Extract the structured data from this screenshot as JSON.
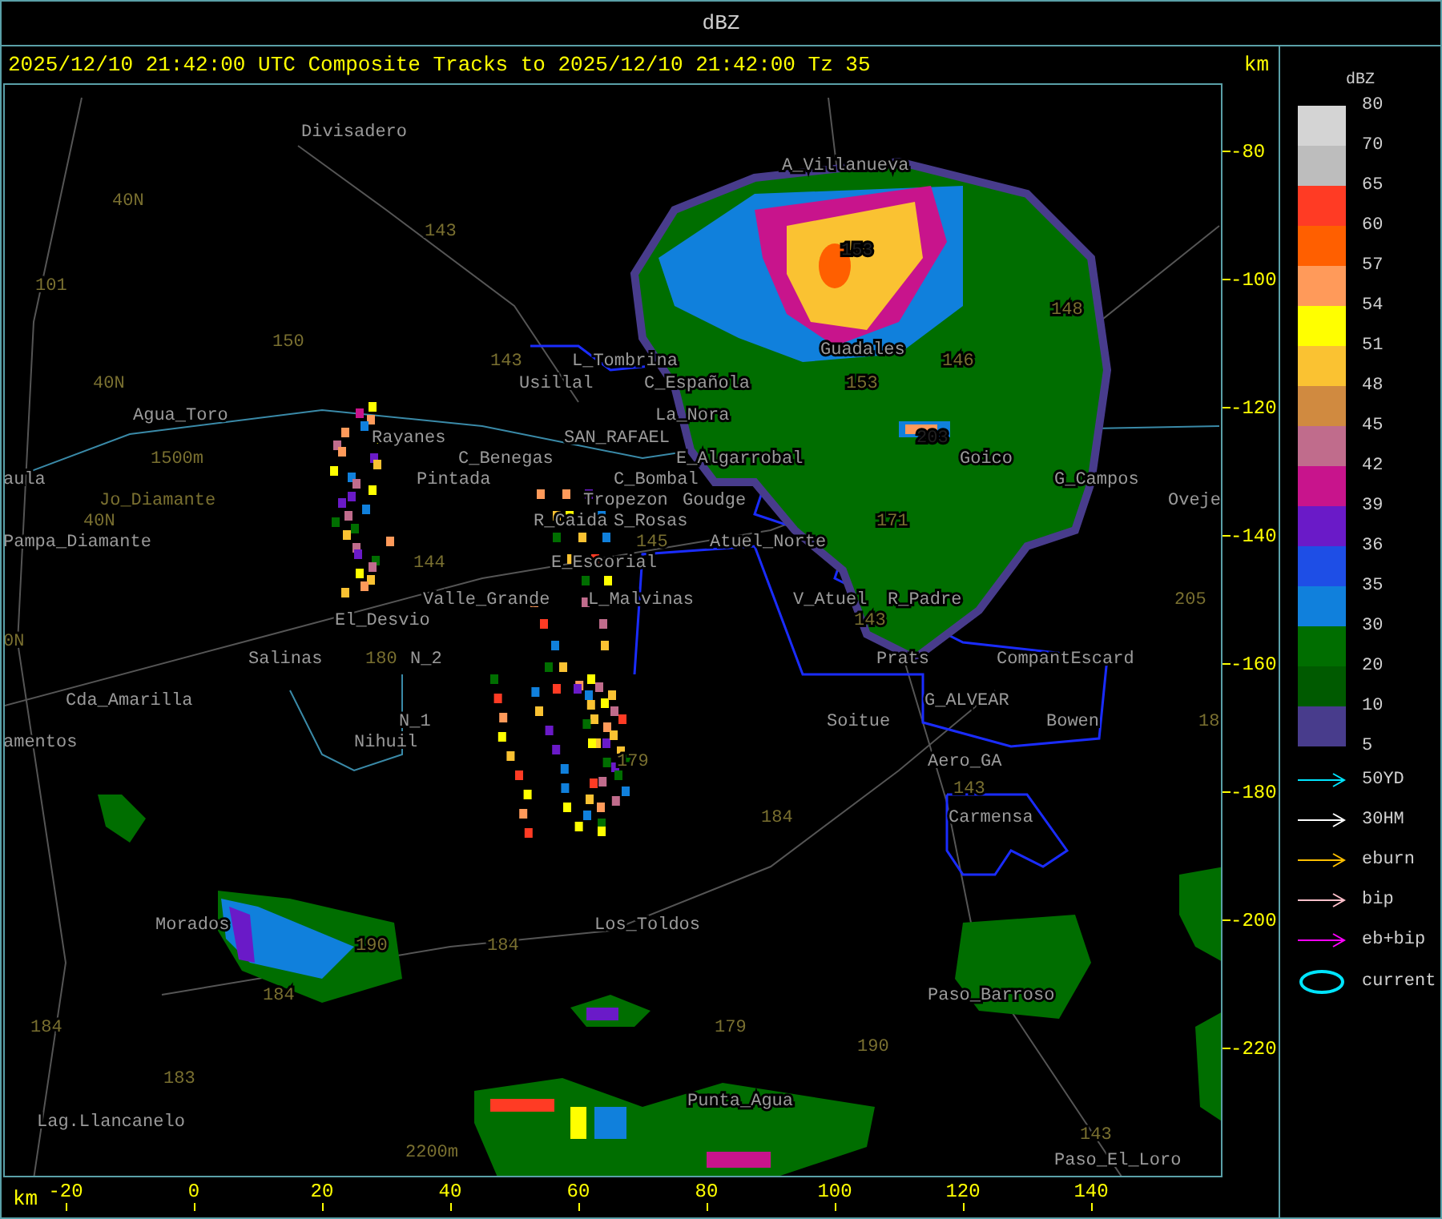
{
  "window": {
    "title": "dBZ"
  },
  "header": {
    "caption": "2025/12/10 21:42:00 UTC Composite Tracks to 2025/12/10 21:42:00 Tz 35",
    "unit": "km"
  },
  "map": {
    "labels": [
      {
        "text": "Divisadero",
        "kind": "place"
      },
      {
        "text": "A_Villanueva",
        "kind": "place"
      },
      {
        "text": "40N",
        "kind": "route"
      },
      {
        "text": "143",
        "kind": "route"
      },
      {
        "text": "153",
        "kind": "route_dark"
      },
      {
        "text": "101",
        "kind": "route"
      },
      {
        "text": "148",
        "kind": "route"
      },
      {
        "text": "150",
        "kind": "route"
      },
      {
        "text": "Guadales",
        "kind": "place"
      },
      {
        "text": "143",
        "kind": "route"
      },
      {
        "text": "L_Tombrina",
        "kind": "place"
      },
      {
        "text": "146",
        "kind": "route"
      },
      {
        "text": "40N",
        "kind": "route"
      },
      {
        "text": "Usillal",
        "kind": "place"
      },
      {
        "text": "C_Española",
        "kind": "place"
      },
      {
        "text": "153",
        "kind": "route"
      },
      {
        "text": "Agua_Toro",
        "kind": "place"
      },
      {
        "text": "La_Nora",
        "kind": "place"
      },
      {
        "text": "Rayanes",
        "kind": "place"
      },
      {
        "text": "SAN_RAFAEL",
        "kind": "place"
      },
      {
        "text": "203",
        "kind": "route_dark"
      },
      {
        "text": "1500m",
        "kind": "route"
      },
      {
        "text": "C_Benegas",
        "kind": "place"
      },
      {
        "text": "E_Algarrobal",
        "kind": "place"
      },
      {
        "text": "Goico",
        "kind": "place"
      },
      {
        "text": "aula",
        "kind": "place"
      },
      {
        "text": "Pintada",
        "kind": "place"
      },
      {
        "text": "C_Bombal",
        "kind": "place"
      },
      {
        "text": "G_Campos",
        "kind": "place"
      },
      {
        "text": "Jo_Diamante",
        "kind": "route"
      },
      {
        "text": "Tropezon",
        "kind": "place"
      },
      {
        "text": "Goudge",
        "kind": "place"
      },
      {
        "text": "Oveje",
        "kind": "place"
      },
      {
        "text": "40N",
        "kind": "route"
      },
      {
        "text": "R_Caida",
        "kind": "place"
      },
      {
        "text": "S_Rosas",
        "kind": "place"
      },
      {
        "text": "171",
        "kind": "route"
      },
      {
        "text": "Pampa_Diamante",
        "kind": "place"
      },
      {
        "text": "145",
        "kind": "route"
      },
      {
        "text": "Atuel_Norte",
        "kind": "place"
      },
      {
        "text": "144",
        "kind": "route"
      },
      {
        "text": "E_Escorial",
        "kind": "place"
      },
      {
        "text": "Valle_Grande",
        "kind": "place"
      },
      {
        "text": "L_Malvinas",
        "kind": "place"
      },
      {
        "text": "V_Atuel",
        "kind": "place"
      },
      {
        "text": "R_Padre",
        "kind": "place"
      },
      {
        "text": "205",
        "kind": "route"
      },
      {
        "text": "El_Desvio",
        "kind": "place"
      },
      {
        "text": "143",
        "kind": "route"
      },
      {
        "text": "0N",
        "kind": "route"
      },
      {
        "text": "Salinas",
        "kind": "place"
      },
      {
        "text": "180",
        "kind": "route"
      },
      {
        "text": "N_2",
        "kind": "place"
      },
      {
        "text": "Prats",
        "kind": "place"
      },
      {
        "text": "CompantEscard",
        "kind": "place"
      },
      {
        "text": "Cda_Amarilla",
        "kind": "place"
      },
      {
        "text": "G_ALVEAR",
        "kind": "place"
      },
      {
        "text": "N_1",
        "kind": "place"
      },
      {
        "text": "Soitue",
        "kind": "place"
      },
      {
        "text": "Bowen",
        "kind": "place"
      },
      {
        "text": "18",
        "kind": "route"
      },
      {
        "text": "amentos",
        "kind": "place"
      },
      {
        "text": "Nihuil",
        "kind": "place"
      },
      {
        "text": "179",
        "kind": "route"
      },
      {
        "text": "Aero_GA",
        "kind": "place"
      },
      {
        "text": "143",
        "kind": "route"
      },
      {
        "text": "184",
        "kind": "route"
      },
      {
        "text": "Carmensa",
        "kind": "place"
      },
      {
        "text": "Morados",
        "kind": "place"
      },
      {
        "text": "Los_Toldos",
        "kind": "place"
      },
      {
        "text": "190",
        "kind": "route"
      },
      {
        "text": "184",
        "kind": "route"
      },
      {
        "text": "184",
        "kind": "route"
      },
      {
        "text": "Paso_Barroso",
        "kind": "place"
      },
      {
        "text": "184",
        "kind": "route"
      },
      {
        "text": "179",
        "kind": "route"
      },
      {
        "text": "190",
        "kind": "route"
      },
      {
        "text": "183",
        "kind": "route"
      },
      {
        "text": "Punta_Agua",
        "kind": "place"
      },
      {
        "text": "Lag.Llancanelo",
        "kind": "place"
      },
      {
        "text": "143",
        "kind": "route"
      },
      {
        "text": "2200m",
        "kind": "route"
      },
      {
        "text": "Paso_El_Loro",
        "kind": "place"
      }
    ]
  },
  "y_axis": {
    "ticks": [
      "-80",
      "-100",
      "-120",
      "-140",
      "-160",
      "-180",
      "-200",
      "-220"
    ]
  },
  "x_axis": {
    "unit": "km",
    "ticks": [
      "-20",
      "0",
      "20",
      "40",
      "60",
      "80",
      "100",
      "120",
      "140"
    ]
  },
  "legend": {
    "title": "dBZ",
    "swatches": [
      {
        "color": "#d4d4d4"
      },
      {
        "color": "#bdbdbd"
      },
      {
        "color": "#ff3b24"
      },
      {
        "color": "#ff5f00"
      },
      {
        "color": "#ff9a5a"
      },
      {
        "color": "#ffff00"
      },
      {
        "color": "#fac232"
      },
      {
        "color": "#d08a40"
      },
      {
        "color": "#c06c8c"
      },
      {
        "color": "#c8148c"
      },
      {
        "color": "#6a1ac8"
      },
      {
        "color": "#1e4ee6"
      },
      {
        "color": "#1080dc"
      },
      {
        "color": "#006e00"
      },
      {
        "color": "#005a00"
      },
      {
        "color": "#483c8c"
      }
    ],
    "labels": [
      "80",
      "70",
      "65",
      "60",
      "57",
      "54",
      "51",
      "48",
      "45",
      "42",
      "39",
      "36",
      "35",
      "30",
      "20",
      "10",
      "5"
    ],
    "tracks": [
      {
        "label": "50YD",
        "color": "#00e5ff"
      },
      {
        "label": "30HM",
        "color": "#ffffff"
      },
      {
        "label": "eburn",
        "color": "#ffc000"
      },
      {
        "label": "bip",
        "color": "#ffc0cb"
      },
      {
        "label": "eb+bip",
        "color": "#ff00ff"
      }
    ],
    "current": {
      "label": "current",
      "color": "#00e5ff"
    }
  }
}
